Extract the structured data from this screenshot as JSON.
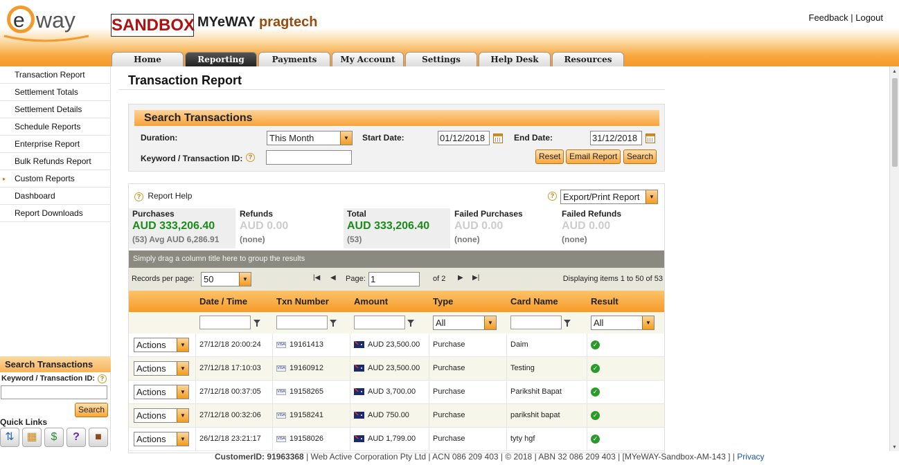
{
  "header": {
    "sandbox_label": "SANDBOX",
    "brand_name": "MYeWAY",
    "merchant": "pragtech",
    "links": {
      "feedback": "Feedback",
      "separator": "|",
      "logout": "Logout"
    },
    "logo_text": "way"
  },
  "tabs": [
    {
      "label": "Home",
      "active": false
    },
    {
      "label": "Reporting",
      "active": true
    },
    {
      "label": "Payments",
      "active": false
    },
    {
      "label": "My Account",
      "active": false
    },
    {
      "label": "Settings",
      "active": false
    },
    {
      "label": "Help Desk",
      "active": false
    },
    {
      "label": "Resources",
      "active": false
    }
  ],
  "sidebar": {
    "items": [
      {
        "label": "Transaction Report"
      },
      {
        "label": "Settlement Totals"
      },
      {
        "label": "Settlement Details"
      },
      {
        "label": "Schedule Reports"
      },
      {
        "label": "Enterprise Report"
      },
      {
        "label": "Bulk Refunds Report"
      },
      {
        "label": "Custom Reports",
        "arrow": "▸"
      },
      {
        "label": "Dashboard"
      },
      {
        "label": "Report Downloads"
      }
    ],
    "search": {
      "title": "Search Transactions",
      "label": "Keyword / Transaction ID:",
      "value": "",
      "button": "Search"
    },
    "quick_links_title": "Quick Links",
    "quick_links": [
      "transactions-icon",
      "calendar-icon",
      "payments-icon",
      "help-icon",
      "briefcase-icon"
    ]
  },
  "page_title": "Transaction Report",
  "search_panel": {
    "title": "Search Transactions",
    "duration_label": "Duration:",
    "duration_value": "This Month",
    "start_label": "Start Date:",
    "start_value": "01/12/2018",
    "end_label": "End Date:",
    "end_value": "31/12/2018",
    "keyword_label": "Keyword / Transaction ID:",
    "keyword_value": "",
    "buttons": {
      "reset": "Reset",
      "email": "Email Report",
      "search": "Search"
    }
  },
  "report": {
    "help_label": "Report Help",
    "export_label": "Export/Print Report",
    "summary": [
      {
        "title": "Purchases",
        "value": "AUD 333,206.40",
        "sub": "(53) Avg AUD 6,286.91",
        "style": "green"
      },
      {
        "title": "Refunds",
        "value": "AUD 0.00",
        "sub": "(none)",
        "style": "grey"
      },
      {
        "title": "Total",
        "value": "AUD 333,206.40",
        "sub": "(53)",
        "style": "green"
      },
      {
        "title": "Failed Purchases",
        "value": "AUD 0.00",
        "sub": "(none)",
        "style": "grey"
      },
      {
        "title": "Failed Refunds",
        "value": "AUD 0.00",
        "sub": "(none)",
        "style": "grey"
      }
    ],
    "group_hint": "Simply drag a column title here to group the results",
    "pager": {
      "records_label": "Records per page:",
      "records_value": "50",
      "page_label": "Page:",
      "page_value": "1",
      "of_label": "of 2",
      "display_text": "Displaying items 1 to 50 of 53"
    },
    "columns": [
      "",
      "Date / Time",
      "Txn Number",
      "Amount",
      "Type",
      "Card Name",
      "Result"
    ],
    "filters": {
      "type": "All",
      "result": "All"
    },
    "rows": [
      {
        "action": "Actions",
        "date": "27/12/18 20:00:24",
        "txn": "19161413",
        "amount": "AUD 23,500.00",
        "type": "Purchase",
        "name": "Daim"
      },
      {
        "action": "Actions",
        "date": "27/12/18 17:10:03",
        "txn": "19160912",
        "amount": "AUD 23,500.00",
        "type": "Purchase",
        "name": "Testing"
      },
      {
        "action": "Actions",
        "date": "27/12/18 00:37:05",
        "txn": "19158265",
        "amount": "AUD 3,700.00",
        "type": "Purchase",
        "name": "Parikshit Bapat"
      },
      {
        "action": "Actions",
        "date": "27/12/18 00:32:06",
        "txn": "19158241",
        "amount": "AUD 750.00",
        "type": "Purchase",
        "name": "parikshit bapat"
      },
      {
        "action": "Actions",
        "date": "26/12/18 23:21:17",
        "txn": "19158026",
        "amount": "AUD 1,799.00",
        "type": "Purchase",
        "name": "tyty hgf"
      }
    ]
  },
  "footer": {
    "customer": "CustomerID: 91963368",
    "text": " | Web Active Corporation Pty Ltd | ACN 086 209 403 | © 2018 | ABN 32 086 209 403 | [MYeWAY-Sandbox-AM-143 ] | ",
    "privacy": "Privacy"
  },
  "colors": {
    "accent": "#f39a2a",
    "success": "#2a9a2a",
    "sandbox": "#b01010"
  }
}
